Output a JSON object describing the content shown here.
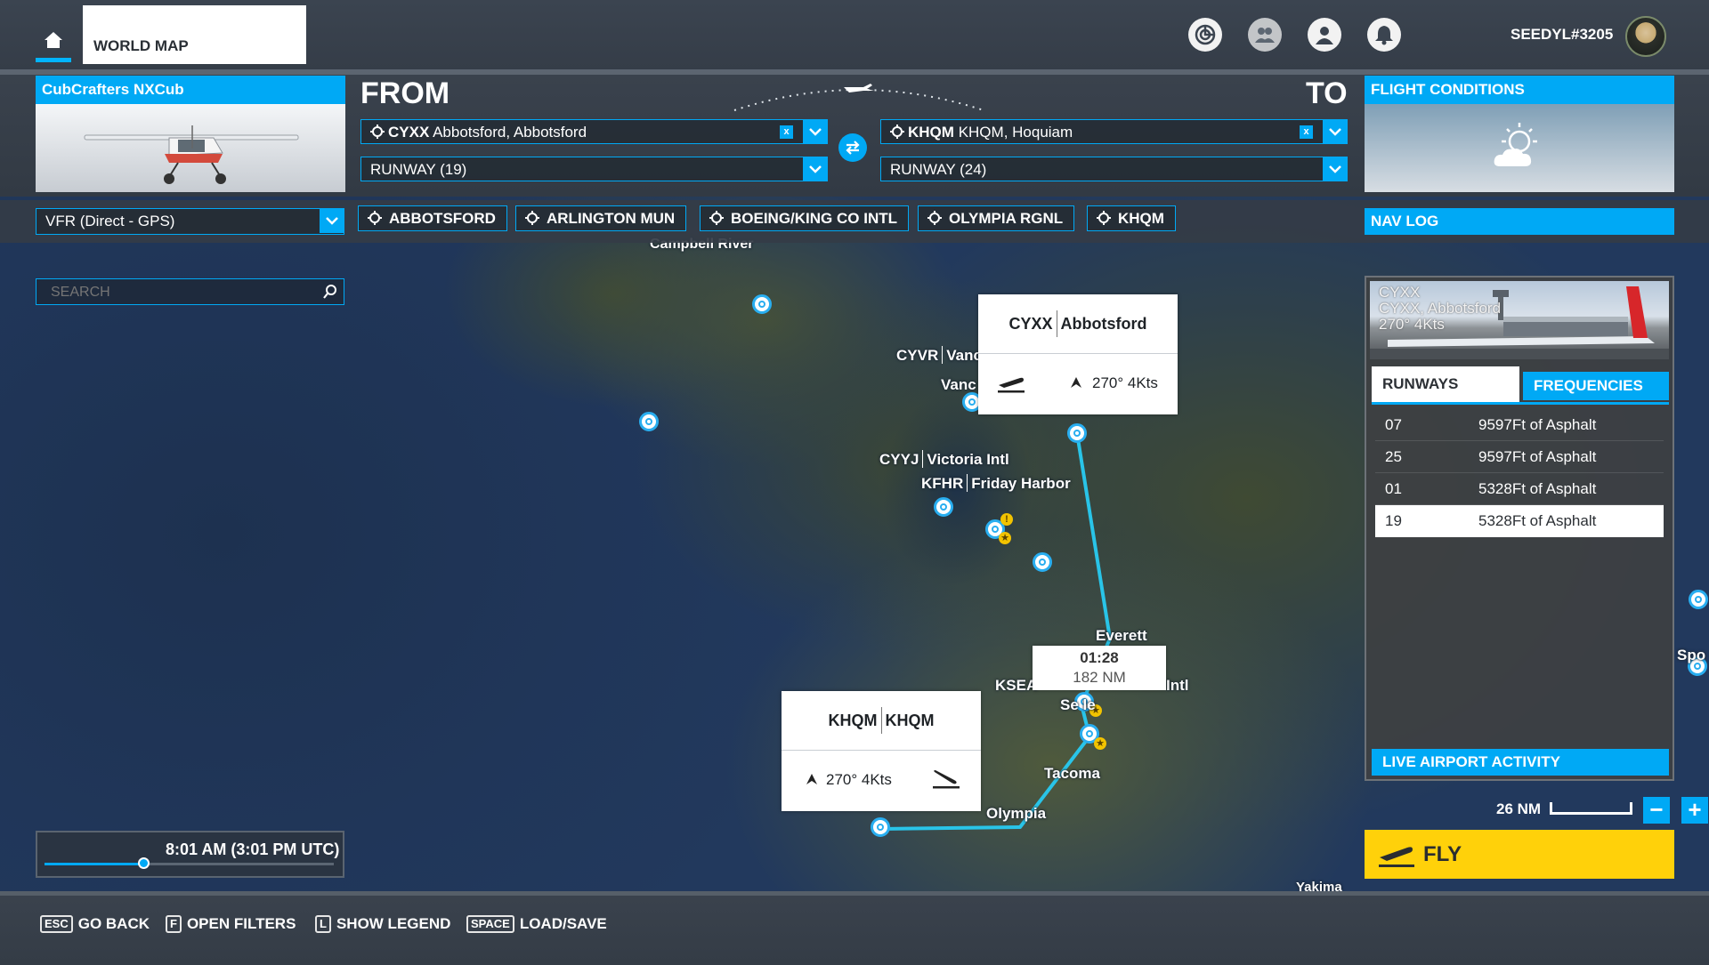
{
  "topbar": {
    "world_map_label": "WORLD MAP",
    "username": "SEEDYL#3205",
    "icons": [
      "rankings-icon",
      "friends-icon",
      "profile-icon",
      "notifications-icon"
    ]
  },
  "aircraft": {
    "name": "CubCrafters NXCub"
  },
  "route": {
    "from_label": "FROM",
    "to_label": "TO",
    "from_code": "CYXX",
    "from_name": "Abbotsford, Abbotsford",
    "to_code": "KHQM",
    "to_name": "KHQM, Hoquiam",
    "from_runway": "RUNWAY (19)",
    "to_runway": "RUNWAY (24)",
    "clear_glyph": "x"
  },
  "flight_conditions": {
    "title": "FLIGHT CONDITIONS",
    "icon": "partly-cloudy-icon"
  },
  "flight_plan": {
    "type": "VFR (Direct - GPS)",
    "waypoints": [
      "ABBOTSFORD",
      "ARLINGTON MUN",
      "BOEING/KING CO INTL",
      "OLYMPIA RGNL",
      "KHQM"
    ]
  },
  "nav_log_label": "NAV LOG",
  "search": {
    "placeholder": "SEARCH"
  },
  "time": {
    "label": "8:01 AM (3:01 PM UTC)",
    "slider_fraction": 0.34
  },
  "bottom_hints": [
    {
      "key": "ESC",
      "label": "GO BACK"
    },
    {
      "key": "F",
      "label": "OPEN FILTERS"
    },
    {
      "key": "L",
      "label": "SHOW LEGEND"
    },
    {
      "key": "SPACE",
      "label": "LOAD/SAVE"
    }
  ],
  "airport_panel": {
    "photo_lines": [
      "CYXX",
      "CYXX, Abbotsford",
      "270° 4Kts"
    ],
    "tab_runways": "RUNWAYS",
    "tab_frequencies": "FREQUENCIES",
    "runways": [
      {
        "num": "07",
        "desc": "9597Ft of Asphalt",
        "selected": false
      },
      {
        "num": "25",
        "desc": "9597Ft of Asphalt",
        "selected": false
      },
      {
        "num": "01",
        "desc": "5328Ft of Asphalt",
        "selected": false
      },
      {
        "num": "19",
        "desc": "5328Ft of Asphalt",
        "selected": true
      }
    ],
    "live_activity": "LIVE AIRPORT ACTIVITY"
  },
  "map": {
    "scale_label": "26 NM",
    "zoom_out": "−",
    "zoom_in": "+",
    "labels": {
      "campbell_river": "Campbell River",
      "cyvr_code": "CYVR",
      "cyvr_name": "Vanc",
      "vanc": "Vanc",
      "cyyj_code": "CYYJ",
      "cyyj_name": "Victoria Intl",
      "kfhr_code": "KFHR",
      "kfhr_name": "Friday Harbor",
      "everett": "Everett",
      "ksea": "KSEA",
      "intl": "Intl",
      "seattle": "Se   le",
      "tacoma": "Tacoma",
      "olympia": "Olympia",
      "spok": "Spo",
      "yakima": "Yakima"
    },
    "origin_popup": {
      "code": "CYXX",
      "name": "Abbotsford",
      "wind": "270° 4Kts"
    },
    "dest_popup": {
      "code": "KHQM",
      "name": "KHQM",
      "wind": "270° 4Kts"
    },
    "route_time": "01:28",
    "route_distance": "182 NM"
  },
  "fly_label": "FLY",
  "colors": {
    "accent": "#00a9f5",
    "fly": "#ffd10a",
    "route": "#29c4e8"
  }
}
